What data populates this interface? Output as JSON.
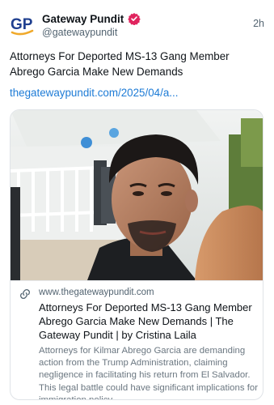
{
  "post": {
    "author": {
      "display_name": "Gateway Pundit",
      "handle": "@gatewaypundit",
      "avatar_text": "GP",
      "verified_icon": "verified-badge-icon"
    },
    "timestamp": "2h",
    "text": "Attorneys For Deported MS-13 Gang Member Abrego Garcia Make New Demands",
    "link_text": "thegatewaypundit.com/2025/04/a..."
  },
  "card": {
    "domain": "www.thegatewaypundit.com",
    "title": "Attorneys For Deported MS-13 Gang Member Abrego Garcia Make New Demands | The Gateway Pundit | by Cristina Laila",
    "description": "Attorneys for Kilmar Abrego Garcia are demanding action from the Trump Administration, claiming negligence in facilitating his return from El Salvador. This legal battle could have significant implications for immigration policy.",
    "link_icon": "link-icon"
  },
  "colors": {
    "text": "#0f1419",
    "secondary": "#536471",
    "link": "#1d7bd6",
    "avatar_blue": "#1f3f8f",
    "avatar_gold": "#f0a92a",
    "verified": "#e0245e"
  }
}
